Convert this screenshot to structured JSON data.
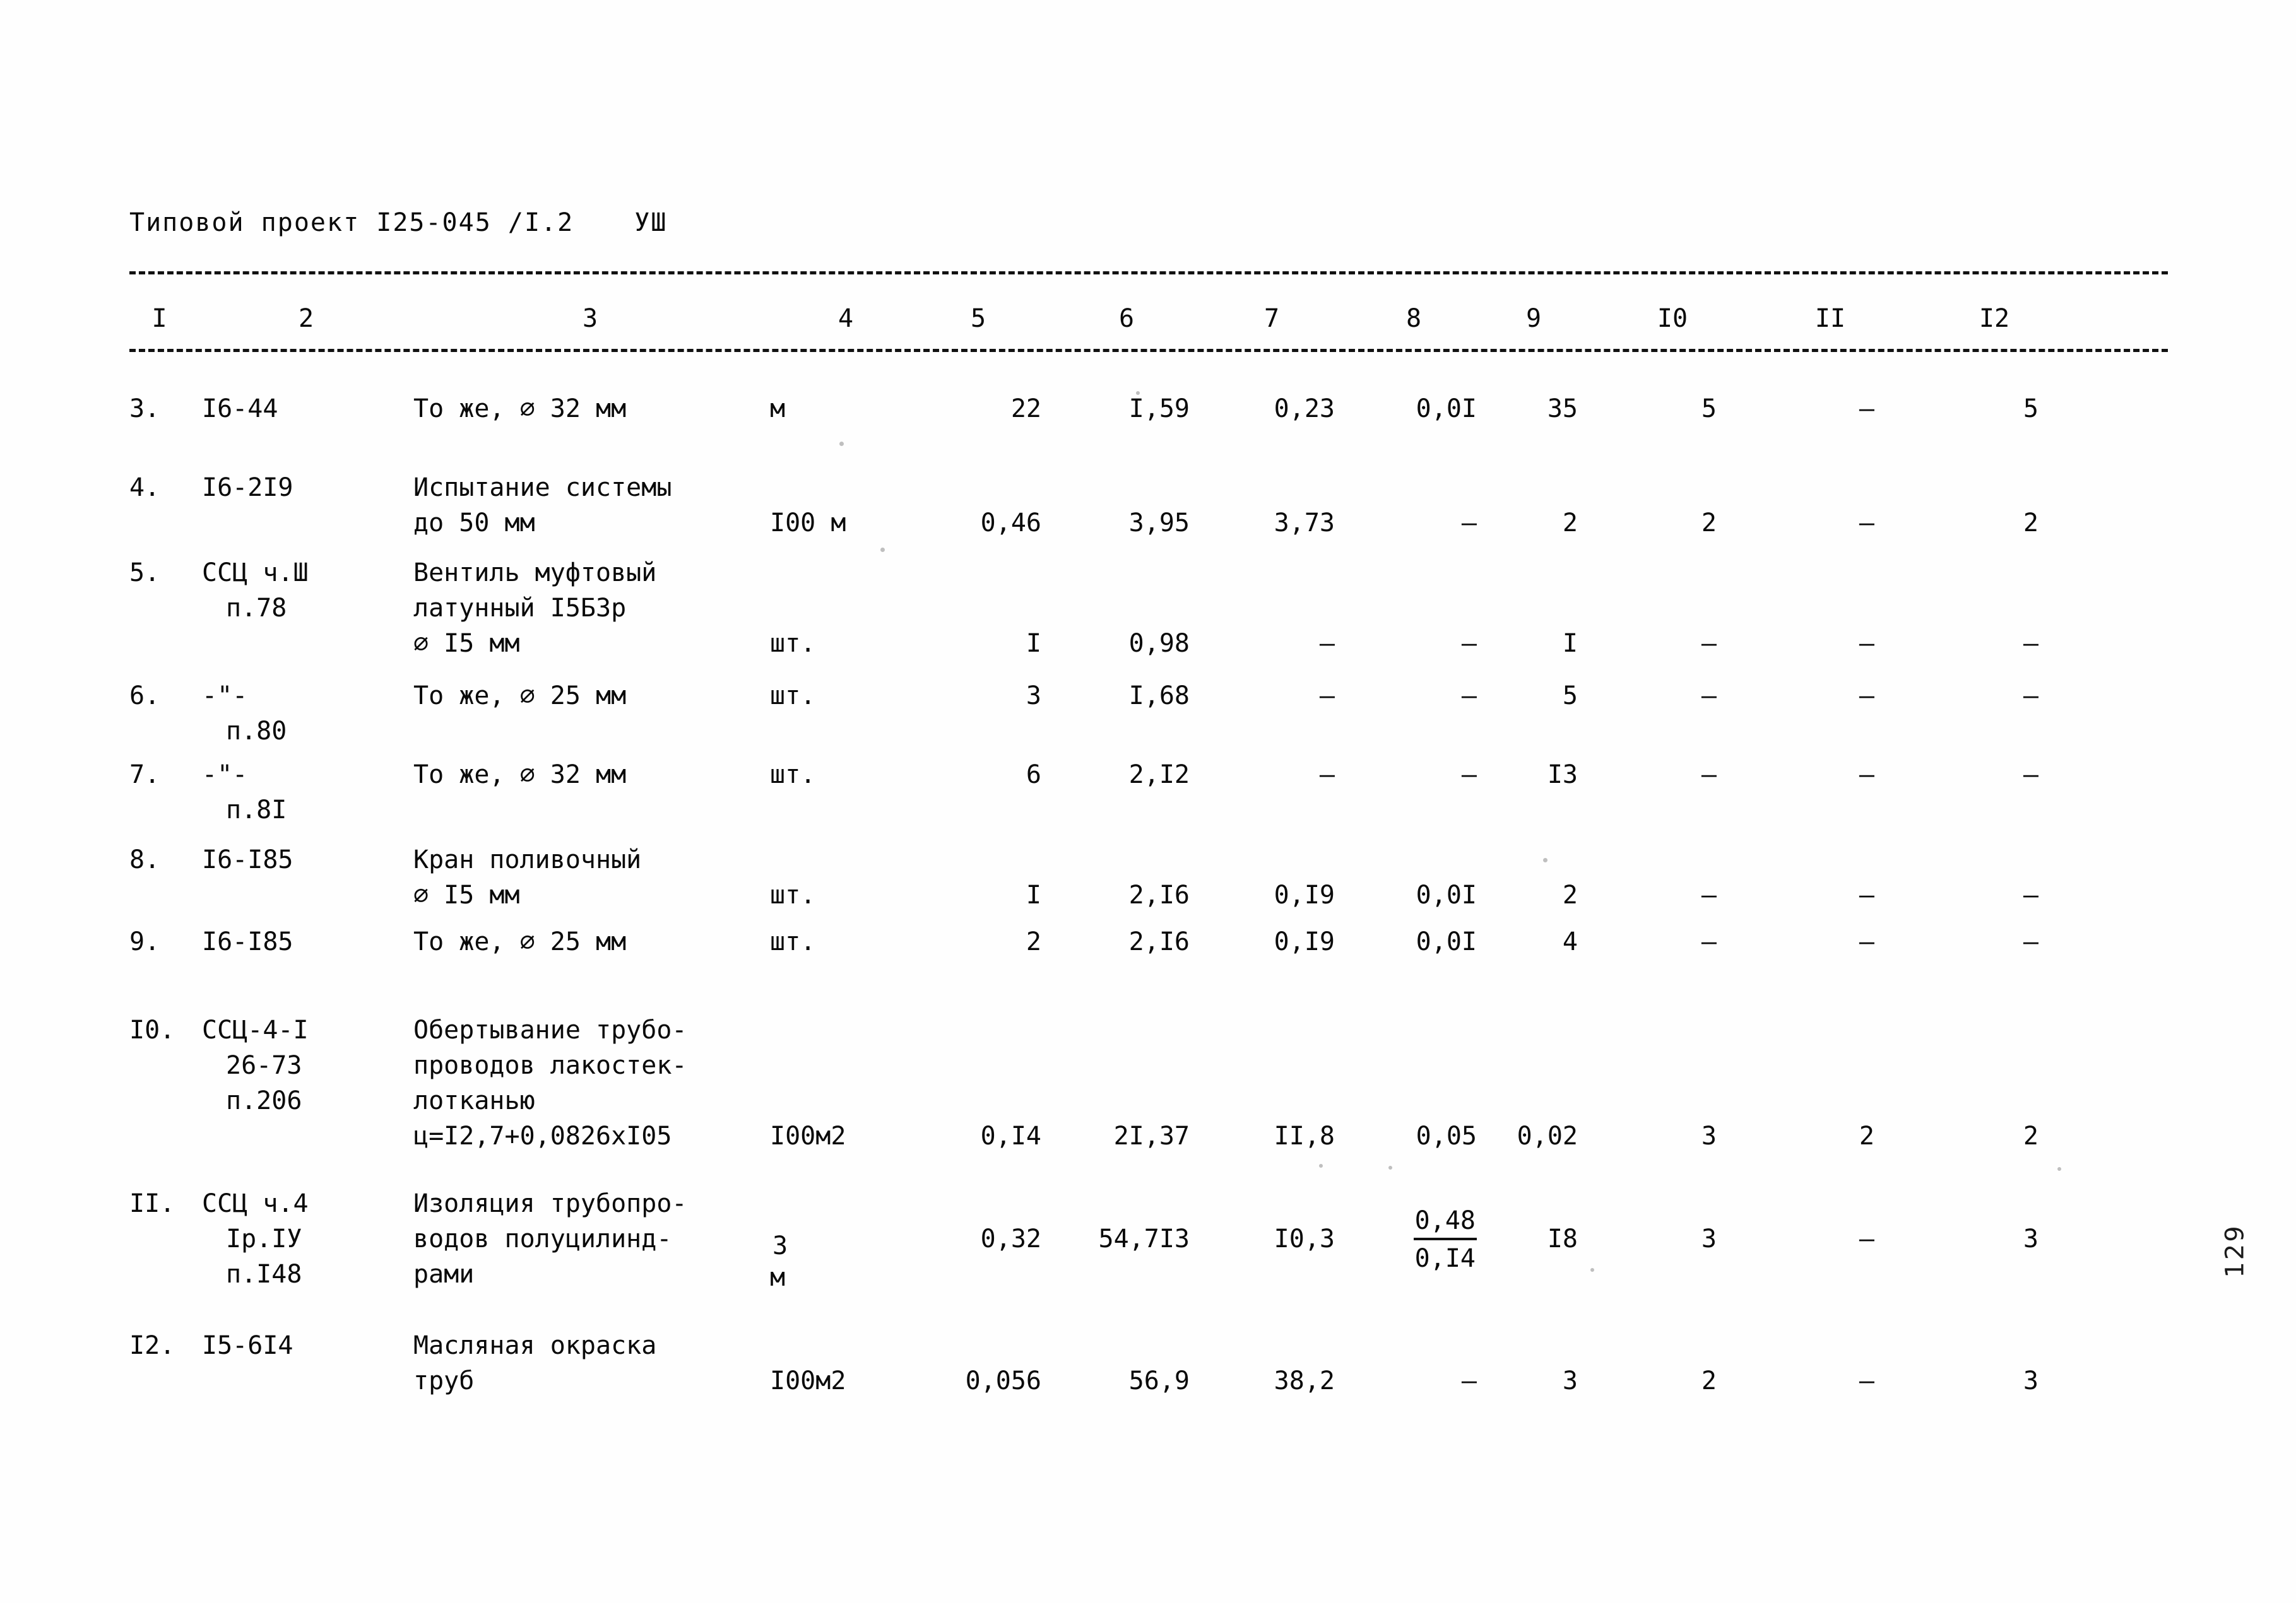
{
  "header": {
    "title": "Типовой проект I25-045 /I.2",
    "sheet_marker": "УШ"
  },
  "table": {
    "column_numbers": [
      "I",
      "2",
      "3",
      "4",
      "5",
      "6",
      "7",
      "8",
      "9",
      "I0",
      "II",
      "I2"
    ],
    "rows": [
      {
        "num": "3.",
        "code": "I6-44",
        "code_line2": "",
        "code_line3": "",
        "desc": "То же, ∅ 32 мм",
        "desc_line2": "",
        "desc_line3": "",
        "desc_line4": "",
        "unit": "м",
        "c5": "22",
        "c6": "I,59",
        "c7": "0,23",
        "c8": "0,0I",
        "c9": "35",
        "c10": "5",
        "c11": "–",
        "c12": "5"
      },
      {
        "num": "4.",
        "code": "I6-2I9",
        "code_line2": "",
        "code_line3": "",
        "desc": "Испытание системы",
        "desc_line2": "до 50 мм",
        "desc_line3": "",
        "desc_line4": "",
        "unit": "I00 м",
        "c5": "0,46",
        "c6": "3,95",
        "c7": "3,73",
        "c8": "–",
        "c9": "2",
        "c10": "2",
        "c11": "–",
        "c12": "2"
      },
      {
        "num": "5.",
        "code": "ССЦ ч.Ш",
        "code_line2": "п.78",
        "code_line3": "",
        "desc": "Вентиль муфтовый",
        "desc_line2": "латунный I5Б3р",
        "desc_line3": "∅ I5 мм",
        "desc_line4": "",
        "unit": "шт.",
        "c5": "I",
        "c6": "0,98",
        "c7": "–",
        "c8": "–",
        "c9": "I",
        "c10": "–",
        "c11": "–",
        "c12": "–"
      },
      {
        "num": "6.",
        "code": "-\"-",
        "code_line2": "п.80",
        "code_line3": "",
        "desc": "То же, ∅ 25 мм",
        "desc_line2": "",
        "desc_line3": "",
        "desc_line4": "",
        "unit": "шт.",
        "c5": "3",
        "c6": "I,68",
        "c7": "–",
        "c8": "–",
        "c9": "5",
        "c10": "–",
        "c11": "–",
        "c12": "–"
      },
      {
        "num": "7.",
        "code": "-\"-",
        "code_line2": "п.8I",
        "code_line3": "",
        "desc": "То же, ∅ 32 мм",
        "desc_line2": "",
        "desc_line3": "",
        "desc_line4": "",
        "unit": "шт.",
        "c5": "6",
        "c6": "2,I2",
        "c7": "–",
        "c8": "–",
        "c9": "I3",
        "c10": "–",
        "c11": "–",
        "c12": "–"
      },
      {
        "num": "8.",
        "code": "I6-I85",
        "code_line2": "",
        "code_line3": "",
        "desc": "Кран поливочный",
        "desc_line2": "∅ I5 мм",
        "desc_line3": "",
        "desc_line4": "",
        "unit": "шт.",
        "c5": "I",
        "c6": "2,I6",
        "c7": "0,I9",
        "c8": "0,0I",
        "c9": "2",
        "c10": "–",
        "c11": "–",
        "c12": "–"
      },
      {
        "num": "9.",
        "code": "I6-I85",
        "code_line2": "",
        "code_line3": "",
        "desc": "То же, ∅ 25 мм",
        "desc_line2": "",
        "desc_line3": "",
        "desc_line4": "",
        "unit": "шт.",
        "c5": "2",
        "c6": "2,I6",
        "c7": "0,I9",
        "c8": "0,0I",
        "c9": "4",
        "c10": "–",
        "c11": "–",
        "c12": "–"
      },
      {
        "num": "I0.",
        "code": "ССЦ-4-I",
        "code_line2": "26-73",
        "code_line3": "п.206",
        "desc": "Обертывание трубо-",
        "desc_line2": "проводов лакостек-",
        "desc_line3": "лотканью",
        "desc_line4": "ц=I2,7+0,0826хI05",
        "unit": "I00м2",
        "c5": "0,I4",
        "c6": "2I,37",
        "c7": "II,8",
        "c8": "0,05",
        "c9": "0,02",
        "c10": "3",
        "c11": "2",
        "c12": "2"
      },
      {
        "num": "II.",
        "code": "ССЦ ч.4",
        "code_line2": "Iр.IУ",
        "code_line3": "п.I48",
        "desc": "Изоляция трубопро-",
        "desc_line2": "водов полуцилинд-",
        "desc_line3": "рами",
        "desc_line4": "",
        "unit_sup": "3",
        "unit_base": "м",
        "c5": "0,32",
        "c6": "54,7I3",
        "c7": "I0,3",
        "c8_top": "0,48",
        "c8_bottom": "0,I4",
        "c9": "I8",
        "c10": "3",
        "c11": "–",
        "c12": "3"
      },
      {
        "num": "I2.",
        "code": "I5-6I4",
        "code_line2": "",
        "code_line3": "",
        "desc": "Масляная окраска",
        "desc_line2": "труб",
        "desc_line3": "",
        "desc_line4": "",
        "unit": "I00м2",
        "c5": "0,056",
        "c6": "56,9",
        "c7": "38,2",
        "c8": "–",
        "c9": "3",
        "c10": "2",
        "c11": "–",
        "c12": "3"
      }
    ]
  },
  "page_marker": "129"
}
